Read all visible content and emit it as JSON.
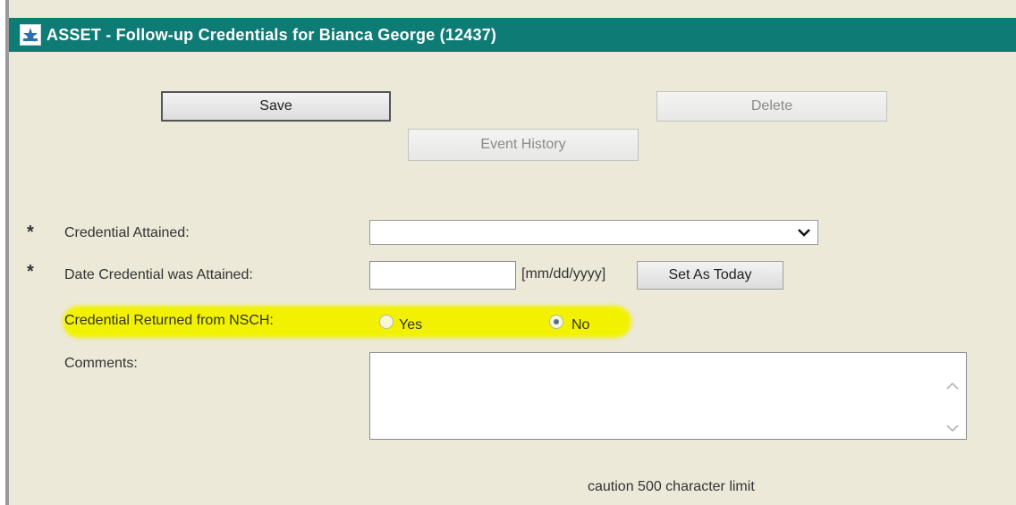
{
  "window": {
    "title": "ASSET - Follow-up Credentials for Bianca George (12437)",
    "titlebar_color": "#0f7b75",
    "icon": "asset-logo-icon"
  },
  "toolbar": {
    "save_label": "Save",
    "delete_label": "Delete",
    "event_history_label": "Event History"
  },
  "form": {
    "required_marker": "*",
    "credential_attained": {
      "label": "Credential Attained:",
      "value": ""
    },
    "date_attained": {
      "label": "Date Credential was Attained:",
      "value": "",
      "format_hint": "[mm/dd/yyyy]",
      "set_today_label": "Set As Today"
    },
    "returned_from_nsch": {
      "label": "Credential Returned from NSCH:",
      "options": [
        "Yes",
        "No"
      ],
      "selected": "No",
      "highlight_color": "#f2f200"
    },
    "comments": {
      "label": "Comments:",
      "value": "",
      "caution": "caution 500 character limit"
    }
  }
}
